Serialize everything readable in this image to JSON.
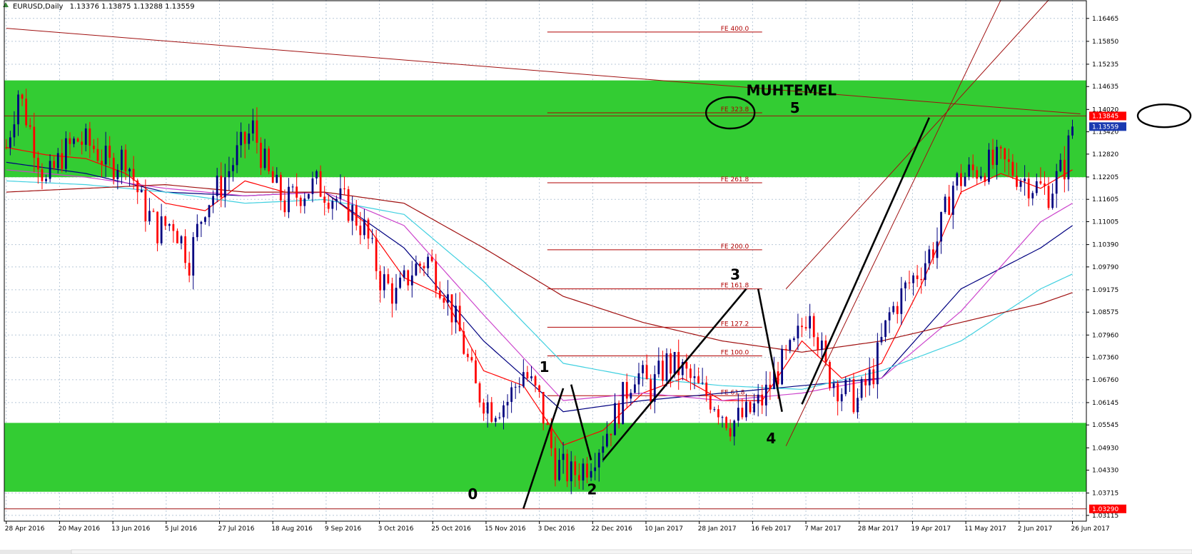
{
  "header": {
    "symbol": "EURUSD,Daily",
    "ohlc": "1.13376 1.13875 1.13288 1.13559"
  },
  "colors": {
    "zone": "#33cc33",
    "bull": "#000080",
    "bear": "#ff0000",
    "fib": "#b00000",
    "grid": "#b8c8d8"
  },
  "chart_data": {
    "type": "candlestick",
    "title": "EURUSD,Daily",
    "ylim": [
      1.0296,
      1.1696
    ],
    "y_ticks": [
      "1.16465",
      "1.15850",
      "1.15235",
      "1.14635",
      "1.14020",
      "1.13420",
      "1.12820",
      "1.12205",
      "1.11605",
      "1.11005",
      "1.10390",
      "1.09790",
      "1.09175",
      "1.08575",
      "1.07960",
      "1.07360",
      "1.06760",
      "1.06145",
      "1.05545",
      "1.04930",
      "1.04330",
      "1.03715",
      "1.03115"
    ],
    "x_ticks": [
      "28 Apr 2016",
      "20 May 2016",
      "13 Jun 2016",
      "5 Jul 2016",
      "27 Jul 2016",
      "18 Aug 2016",
      "9 Sep 2016",
      "3 Oct 2016",
      "25 Oct 2016",
      "15 Nov 2016",
      "3 Dec 2016",
      "22 Dec 2016",
      "10 Jan 2017",
      "28 Jan 2017",
      "16 Feb 2017",
      "7 Mar 2017",
      "28 Mar 2017",
      "19 Apr 2017",
      "11 May 2017",
      "2 Jun 2017",
      "26 Jun 2017"
    ],
    "price_path": [
      [
        0,
        1.13
      ],
      [
        3,
        1.145
      ],
      [
        6,
        1.135
      ],
      [
        10,
        1.12
      ],
      [
        14,
        1.128
      ],
      [
        18,
        1.132
      ],
      [
        22,
        1.13
      ],
      [
        26,
        1.125
      ],
      [
        30,
        1.128
      ],
      [
        34,
        1.115
      ],
      [
        38,
        1.108
      ],
      [
        42,
        1.11
      ],
      [
        46,
        1.1
      ],
      [
        50,
        1.115
      ],
      [
        54,
        1.12
      ],
      [
        58,
        1.128
      ],
      [
        62,
        1.135
      ],
      [
        66,
        1.122
      ],
      [
        70,
        1.115
      ],
      [
        74,
        1.118
      ],
      [
        78,
        1.12
      ],
      [
        82,
        1.117
      ],
      [
        86,
        1.114
      ],
      [
        90,
        1.108
      ],
      [
        94,
        1.095
      ],
      [
        98,
        1.09
      ],
      [
        102,
        1.097
      ],
      [
        106,
        1.1
      ],
      [
        110,
        1.092
      ],
      [
        114,
        1.08
      ],
      [
        118,
        1.065
      ],
      [
        122,
        1.06
      ],
      [
        126,
        1.062
      ],
      [
        130,
        1.07
      ],
      [
        134,
        1.062
      ],
      [
        138,
        1.045
      ],
      [
        142,
        1.042
      ],
      [
        146,
        1.045
      ],
      [
        150,
        1.052
      ],
      [
        154,
        1.06
      ],
      [
        158,
        1.07
      ],
      [
        162,
        1.065
      ],
      [
        166,
        1.072
      ],
      [
        170,
        1.07
      ],
      [
        174,
        1.065
      ],
      [
        178,
        1.062
      ],
      [
        182,
        1.056
      ],
      [
        186,
        1.058
      ],
      [
        190,
        1.062
      ],
      [
        194,
        1.07
      ],
      [
        198,
        1.076
      ],
      [
        202,
        1.088
      ],
      [
        206,
        1.07
      ],
      [
        210,
        1.065
      ],
      [
        214,
        1.062
      ],
      [
        218,
        1.07
      ],
      [
        222,
        1.085
      ],
      [
        226,
        1.092
      ],
      [
        230,
        1.098
      ],
      [
        234,
        1.105
      ],
      [
        238,
        1.12
      ],
      [
        242,
        1.123
      ],
      [
        246,
        1.125
      ],
      [
        250,
        1.126
      ],
      [
        254,
        1.123
      ],
      [
        258,
        1.12
      ],
      [
        262,
        1.118
      ],
      [
        266,
        1.125
      ],
      [
        268,
        1.1356
      ]
    ],
    "last_bar_index": 268,
    "series": [
      {
        "name": "",
        "color": "#ff0000",
        "values": [
          [
            0,
            1.13
          ],
          [
            10,
            1.128
          ],
          [
            20,
            1.127
          ],
          [
            30,
            1.123
          ],
          [
            40,
            1.115
          ],
          [
            50,
            1.113
          ],
          [
            60,
            1.121
          ],
          [
            70,
            1.118
          ],
          [
            80,
            1.118
          ],
          [
            90,
            1.11
          ],
          [
            100,
            1.095
          ],
          [
            110,
            1.09
          ],
          [
            120,
            1.07
          ],
          [
            130,
            1.066
          ],
          [
            140,
            1.05
          ],
          [
            150,
            1.054
          ],
          [
            160,
            1.064
          ],
          [
            170,
            1.068
          ],
          [
            180,
            1.062
          ],
          [
            190,
            1.062
          ],
          [
            200,
            1.078
          ],
          [
            210,
            1.068
          ],
          [
            220,
            1.072
          ],
          [
            230,
            1.093
          ],
          [
            240,
            1.118
          ],
          [
            250,
            1.123
          ],
          [
            260,
            1.119
          ],
          [
            268,
            1.124
          ]
        ]
      },
      {
        "name": "",
        "color": "#000080",
        "values": [
          [
            0,
            1.126
          ],
          [
            20,
            1.123
          ],
          [
            40,
            1.118
          ],
          [
            60,
            1.117
          ],
          [
            80,
            1.118
          ],
          [
            100,
            1.103
          ],
          [
            120,
            1.078
          ],
          [
            140,
            1.059
          ],
          [
            160,
            1.062
          ],
          [
            180,
            1.064
          ],
          [
            200,
            1.066
          ],
          [
            220,
            1.068
          ],
          [
            240,
            1.092
          ],
          [
            260,
            1.103
          ],
          [
            268,
            1.109
          ]
        ]
      },
      {
        "name": "",
        "color": "#cc44cc",
        "values": [
          [
            0,
            1.124
          ],
          [
            20,
            1.122
          ],
          [
            40,
            1.119
          ],
          [
            60,
            1.117
          ],
          [
            80,
            1.118
          ],
          [
            100,
            1.109
          ],
          [
            120,
            1.085
          ],
          [
            140,
            1.062
          ],
          [
            160,
            1.064
          ],
          [
            180,
            1.062
          ],
          [
            200,
            1.064
          ],
          [
            220,
            1.068
          ],
          [
            240,
            1.086
          ],
          [
            260,
            1.11
          ],
          [
            268,
            1.115
          ]
        ]
      },
      {
        "name": "",
        "color": "#40d0e0",
        "values": [
          [
            0,
            1.121
          ],
          [
            20,
            1.12
          ],
          [
            40,
            1.118
          ],
          [
            60,
            1.115
          ],
          [
            80,
            1.116
          ],
          [
            100,
            1.112
          ],
          [
            120,
            1.094
          ],
          [
            140,
            1.072
          ],
          [
            160,
            1.068
          ],
          [
            180,
            1.066
          ],
          [
            200,
            1.065
          ],
          [
            220,
            1.07
          ],
          [
            240,
            1.078
          ],
          [
            260,
            1.092
          ],
          [
            268,
            1.096
          ]
        ]
      },
      {
        "name": "",
        "color": "#a01010",
        "values": [
          [
            0,
            1.118
          ],
          [
            20,
            1.119
          ],
          [
            40,
            1.12
          ],
          [
            60,
            1.118
          ],
          [
            80,
            1.118
          ],
          [
            100,
            1.115
          ],
          [
            120,
            1.103
          ],
          [
            140,
            1.09
          ],
          [
            160,
            1.083
          ],
          [
            180,
            1.078
          ],
          [
            200,
            1.075
          ],
          [
            220,
            1.078
          ],
          [
            240,
            1.083
          ],
          [
            260,
            1.088
          ],
          [
            268,
            1.091
          ]
        ]
      }
    ],
    "trendlines": [
      {
        "from": [
          0,
          1.162
        ],
        "to": [
          270,
          1.139
        ],
        "color": "#a01010",
        "width": 1
      },
      {
        "from": [
          196,
          1.0498
        ],
        "to": [
          250,
          1.1696
        ],
        "color": "#a01010",
        "width": 1
      },
      {
        "from": [
          196,
          1.092
        ],
        "to": [
          262,
          1.1696
        ],
        "color": "#a01010",
        "width": 1
      }
    ],
    "wave_lines": [
      {
        "from": [
          130,
          1.033
        ],
        "to": [
          140,
          1.0653
        ]
      },
      {
        "from": [
          142,
          1.0663
        ],
        "to": [
          147,
          1.046
        ]
      },
      {
        "from": [
          150,
          1.046
        ],
        "to": [
          186,
          1.092
        ]
      },
      {
        "from": [
          189,
          1.092
        ],
        "to": [
          195,
          1.059
        ]
      },
      {
        "from": [
          200,
          1.061
        ],
        "to": [
          232,
          1.138
        ]
      }
    ],
    "zones": [
      {
        "top": 1.148,
        "bottom": 1.122
      },
      {
        "top": 1.056,
        "bottom": 1.0375
      }
    ],
    "fib_levels": [
      {
        "label": "FE 400.0",
        "price": 1.161,
        "x_start": 136,
        "x_end": 190
      },
      {
        "label": "FE 323.8",
        "price": 1.1393,
        "x_start": 136,
        "x_end": 190
      },
      {
        "label": "FE 261.8",
        "price": 1.1205,
        "x_start": 136,
        "x_end": 190
      },
      {
        "label": "FE 200.0",
        "price": 1.1025,
        "x_start": 136,
        "x_end": 190
      },
      {
        "label": "FE 161.8",
        "price": 1.092,
        "x_start": 136,
        "x_end": 190
      },
      {
        "label": "FE 127.2",
        "price": 1.0817,
        "x_start": 136,
        "x_end": 190
      },
      {
        "label": "FE 100.0",
        "price": 1.074,
        "x_start": 136,
        "x_end": 190
      },
      {
        "label": "FE 61.8",
        "price": 1.0633,
        "x_start": 136,
        "x_end": 190
      }
    ],
    "horizontal_lines": [
      {
        "price": 1.13845,
        "color": "#a01010"
      },
      {
        "price": 1.0329,
        "color": "#a01010"
      }
    ],
    "price_tags": [
      {
        "label": "1.13845",
        "price": 1.13845,
        "color": "#ff0000"
      },
      {
        "label": "1.13559",
        "price": 1.13559,
        "color": "#1a3ab0"
      },
      {
        "label": "1.03290",
        "price": 1.0329,
        "color": "#ff0000"
      }
    ],
    "wave_labels": [
      {
        "label": "0",
        "x": 116,
        "price": 1.0355
      },
      {
        "label": "1",
        "x": 134,
        "price": 1.0697
      },
      {
        "label": "2",
        "x": 146,
        "price": 1.0368
      },
      {
        "label": "3",
        "x": 182,
        "price": 1.0945
      },
      {
        "label": "4",
        "x": 191,
        "price": 1.0505
      },
      {
        "label": "5",
        "x": 197,
        "price": 1.1393
      }
    ],
    "annotations": [
      {
        "label": "MUHTEMEL",
        "x": 186,
        "price": 1.144
      }
    ],
    "ellipses": [
      {
        "cx": 182,
        "price": 1.1393,
        "rx": 34,
        "ry": 22
      },
      {
        "cx": 292,
        "price": 1.1385,
        "rx": 37,
        "ry": 16
      }
    ]
  }
}
